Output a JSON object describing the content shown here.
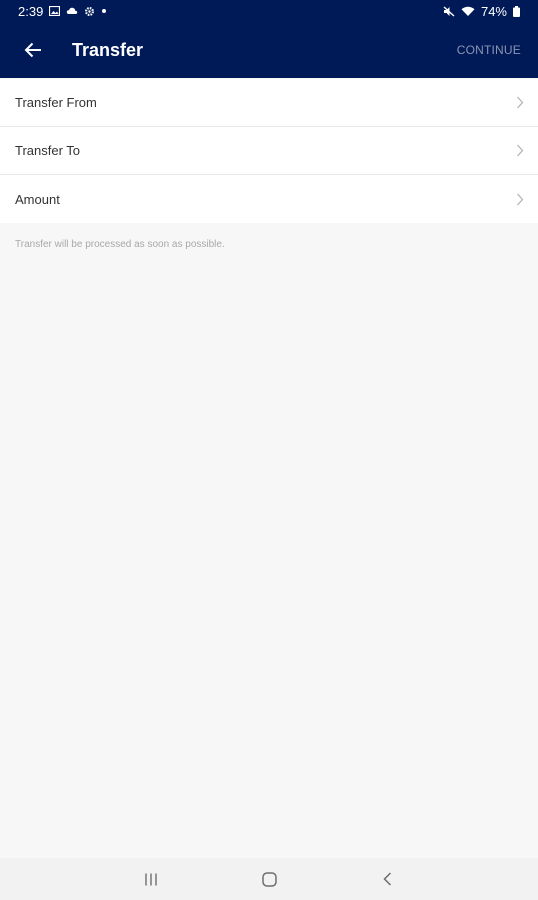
{
  "status_bar": {
    "time": "2:39",
    "battery": "74%",
    "icons": [
      "gallery-icon",
      "cloud-icon",
      "settings-icon",
      "dot-icon",
      "mute-icon",
      "wifi-icon",
      "battery-icon"
    ]
  },
  "app_bar": {
    "title": "Transfer",
    "continue_label": "CONTINUE",
    "back_icon": "arrow-left-icon"
  },
  "form": {
    "rows": [
      {
        "label": "Transfer From"
      },
      {
        "label": "Transfer To"
      },
      {
        "label": "Amount"
      }
    ],
    "note": "Transfer will be processed as soon as possible."
  },
  "nav_bar": {
    "icons": [
      "recents-icon",
      "home-icon",
      "back-icon"
    ]
  },
  "colors": {
    "app_bar": "#001a57",
    "background": "#f7f7f7",
    "continue_disabled": "#8b95b3"
  }
}
